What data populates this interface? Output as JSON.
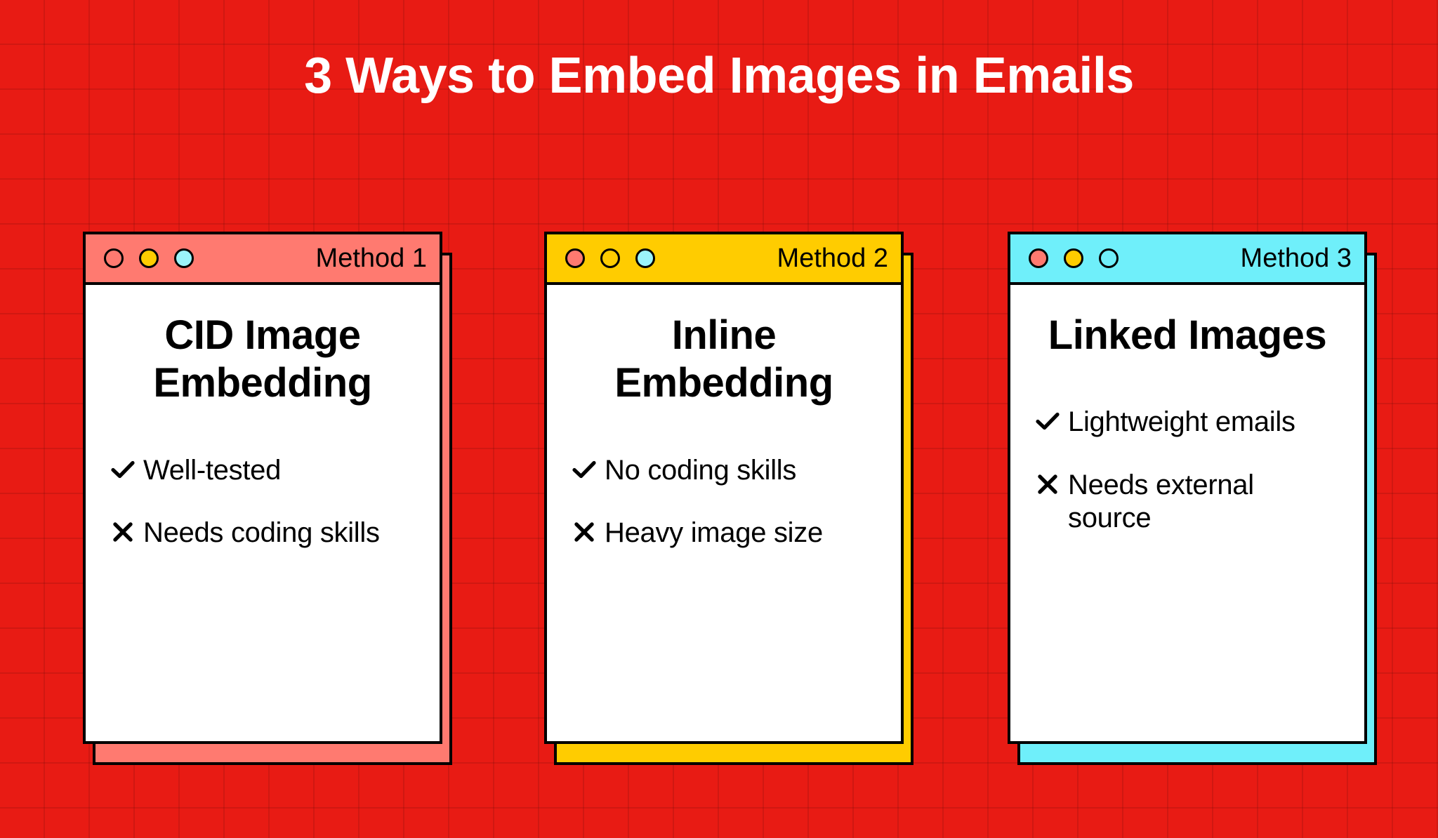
{
  "page": {
    "title": "3 Ways to Embed Images in Emails",
    "background_color": "#E81B14",
    "title_color": "#FFFFFF"
  },
  "colors": {
    "red": "#E81B14",
    "salmon": "#FF7A70",
    "yellow": "#FFCC00",
    "cyan": "#6FEFFA",
    "cyan_light": "#B4F7FC",
    "black": "#000000",
    "white": "#FFFFFF"
  },
  "cards": [
    {
      "header_label": "Method 1",
      "header_color": "#FF7A70",
      "shadow_color": "#FF7A70",
      "dots": [
        {
          "name": "close-dot",
          "fill": "#FF7A70",
          "hollow": true
        },
        {
          "name": "minimize-dot",
          "fill": "#FFCC00",
          "hollow": false
        },
        {
          "name": "maximize-dot",
          "fill": "#9BF3FA",
          "hollow": false
        }
      ],
      "title": "CID Image Embedding",
      "bullets": [
        {
          "icon": "check-icon",
          "type": "pro",
          "text": "Well-tested"
        },
        {
          "icon": "cross-icon",
          "type": "con",
          "text": "Needs coding skills"
        }
      ]
    },
    {
      "header_label": "Method 2",
      "header_color": "#FFCC00",
      "shadow_color": "#FFCC00",
      "dots": [
        {
          "name": "close-dot",
          "fill": "#FF7A70",
          "hollow": false
        },
        {
          "name": "minimize-dot",
          "fill": "#FFCC00",
          "hollow": true
        },
        {
          "name": "maximize-dot",
          "fill": "#9BF3FA",
          "hollow": false
        }
      ],
      "title": "Inline Embedding",
      "bullets": [
        {
          "icon": "check-icon",
          "type": "pro",
          "text": "No coding skills"
        },
        {
          "icon": "cross-icon",
          "type": "con",
          "text": "Heavy image size"
        }
      ]
    },
    {
      "header_label": "Method 3",
      "header_color": "#6FEFFA",
      "shadow_color": "#6FEFFA",
      "dots": [
        {
          "name": "close-dot",
          "fill": "#FF7A70",
          "hollow": false
        },
        {
          "name": "minimize-dot",
          "fill": "#FFCC00",
          "hollow": false
        },
        {
          "name": "maximize-dot",
          "fill": "#B4F7FC",
          "hollow": true
        }
      ],
      "title": "Linked Images",
      "bullets": [
        {
          "icon": "check-icon",
          "type": "pro",
          "text": "Lightweight emails"
        },
        {
          "icon": "cross-icon",
          "type": "con",
          "text": "Needs external source"
        }
      ]
    }
  ]
}
